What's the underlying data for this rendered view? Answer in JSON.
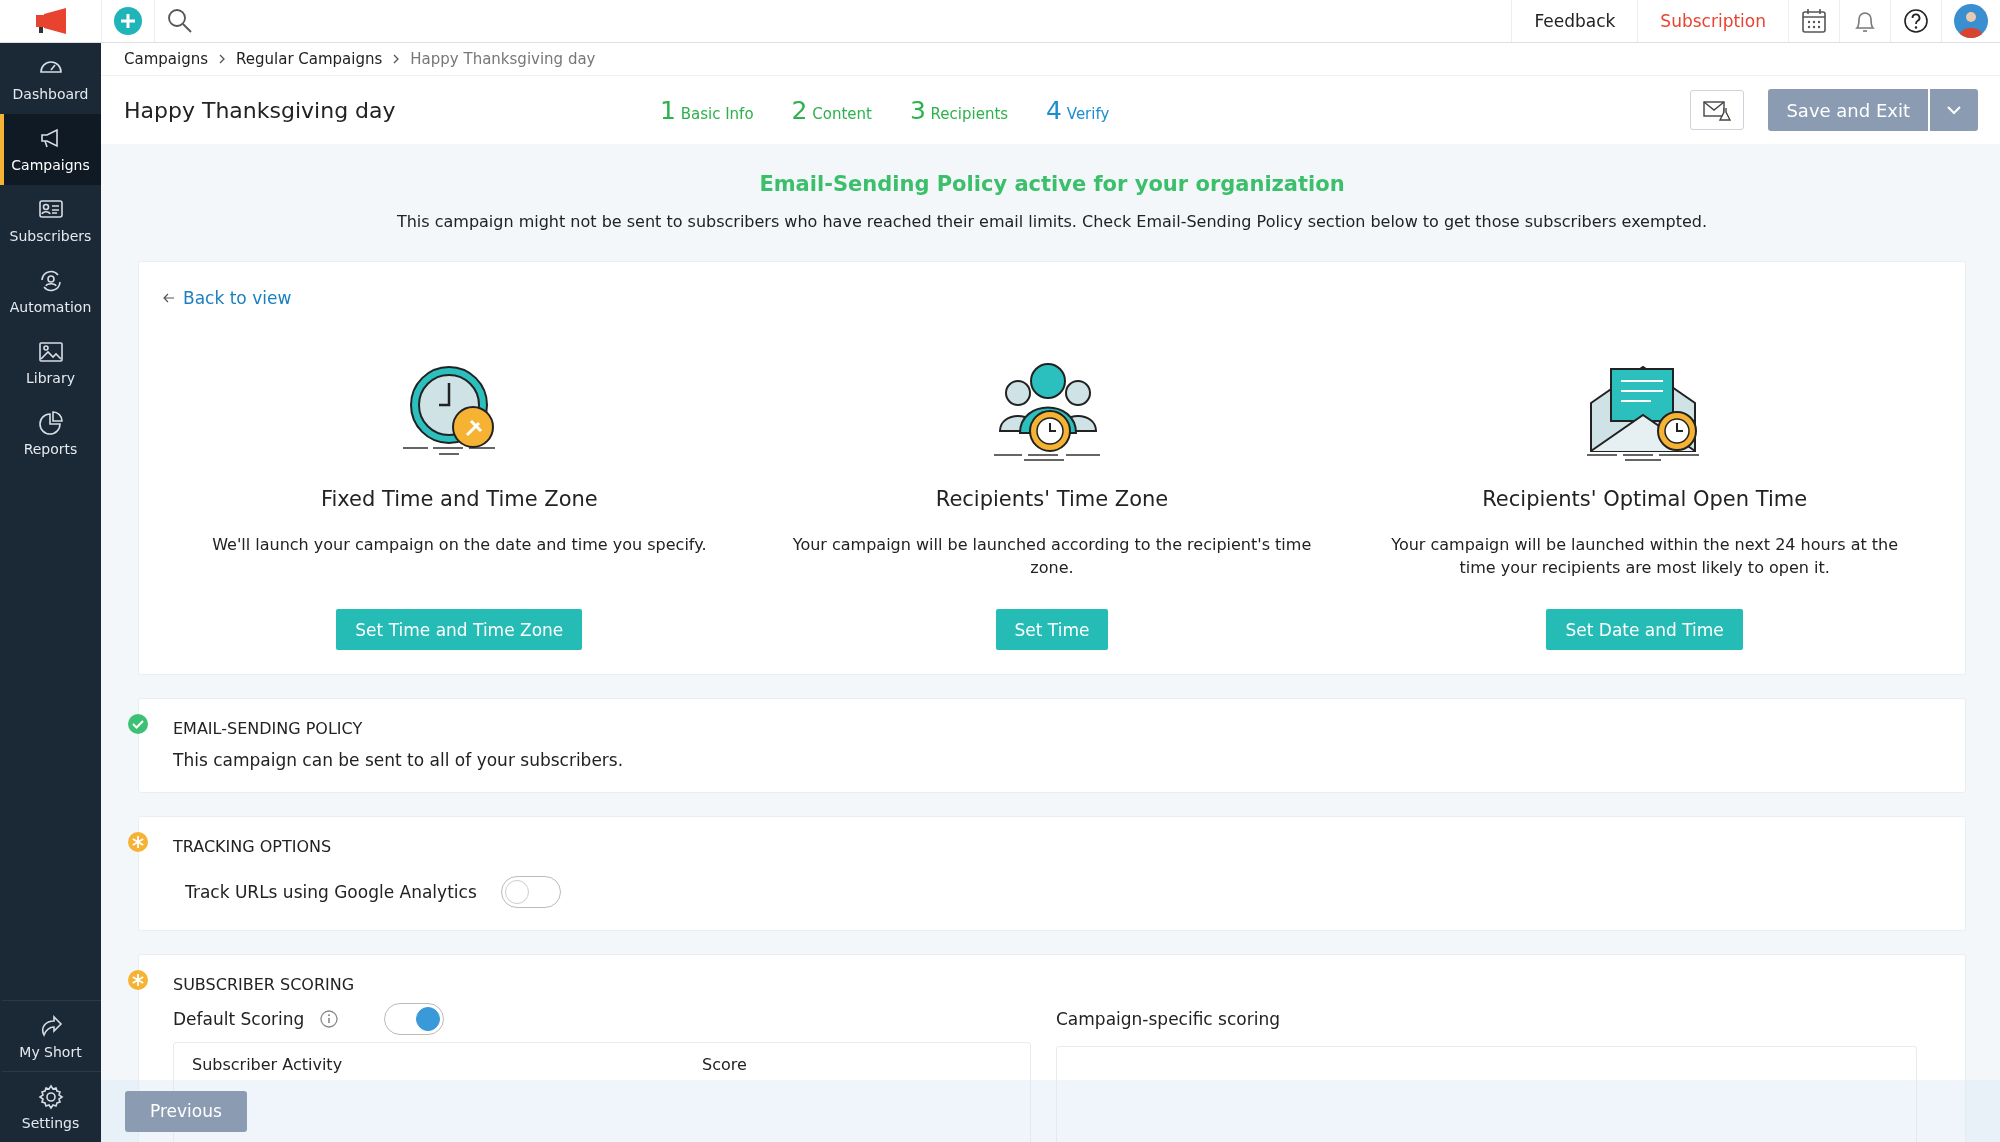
{
  "topbar": {
    "links": [
      {
        "label": "Feedback",
        "kind": "plain"
      },
      {
        "label": "Subscription",
        "kind": "accent"
      }
    ]
  },
  "sidebar": {
    "items": [
      {
        "label": "Dashboard",
        "selected": false
      },
      {
        "label": "Campaigns",
        "selected": true
      },
      {
        "label": "Subscribers",
        "selected": false
      },
      {
        "label": "Automation",
        "selected": false
      },
      {
        "label": "Library",
        "selected": false
      },
      {
        "label": "Reports",
        "selected": false
      }
    ],
    "bottom_items": [
      {
        "label": "My Short",
        "selected": false
      },
      {
        "label": "Settings",
        "selected": false
      }
    ]
  },
  "breadcrumb": [
    "Campaigns",
    "Regular Campaigns",
    "Happy Thanksgiving day"
  ],
  "title": "Happy Thanksgiving day",
  "steps": [
    {
      "number": "1",
      "label": "Basic Info",
      "selected": false
    },
    {
      "number": "2",
      "label": "Content",
      "selected": false
    },
    {
      "number": "3",
      "label": "Recipients",
      "selected": false
    },
    {
      "number": "4",
      "label": "Verify",
      "selected": true
    }
  ],
  "save_button": "Save and Exit",
  "notice": {
    "title": "Email-Sending Policy active for your organization",
    "text": "This campaign might not be sent to subscribers who have reached their email limits. Check Email-Sending Policy section below to get those subscribers exempted."
  },
  "back_link": "Back to view",
  "options": [
    {
      "title": "Fixed Time and Time Zone",
      "text": "We'll launch your campaign on the date and time you specify.",
      "button": "Set Time and Time Zone"
    },
    {
      "title": "Recipients' Time Zone",
      "text": "Your campaign will be launched according to the recipient's time zone.",
      "button": "Set Time"
    },
    {
      "title": "Recipients' Optimal Open Time",
      "text": "Your campaign will be launched within the next 24 hours at the time your recipients are most likely to open it.",
      "button": "Set Date and Time"
    }
  ],
  "sections": [
    {
      "kind": "text",
      "complete": true,
      "title": "EMAIL-SENDING POLICY",
      "text": "This campaign can be sent to all of your subscribers."
    },
    {
      "kind": "toggle",
      "complete": false,
      "title": "TRACKING OPTIONS",
      "label": "Track URLs using Google Analytics",
      "on": false
    },
    {
      "kind": "scoring",
      "complete": false,
      "title": "SUBSCRIBER SCORING",
      "label": "Default Scoring",
      "on": true,
      "right_label": "Campaign-specific scoring",
      "columns": [
        "Subscriber Activity",
        "Score"
      ]
    }
  ],
  "footer": {
    "button": "Previous"
  }
}
